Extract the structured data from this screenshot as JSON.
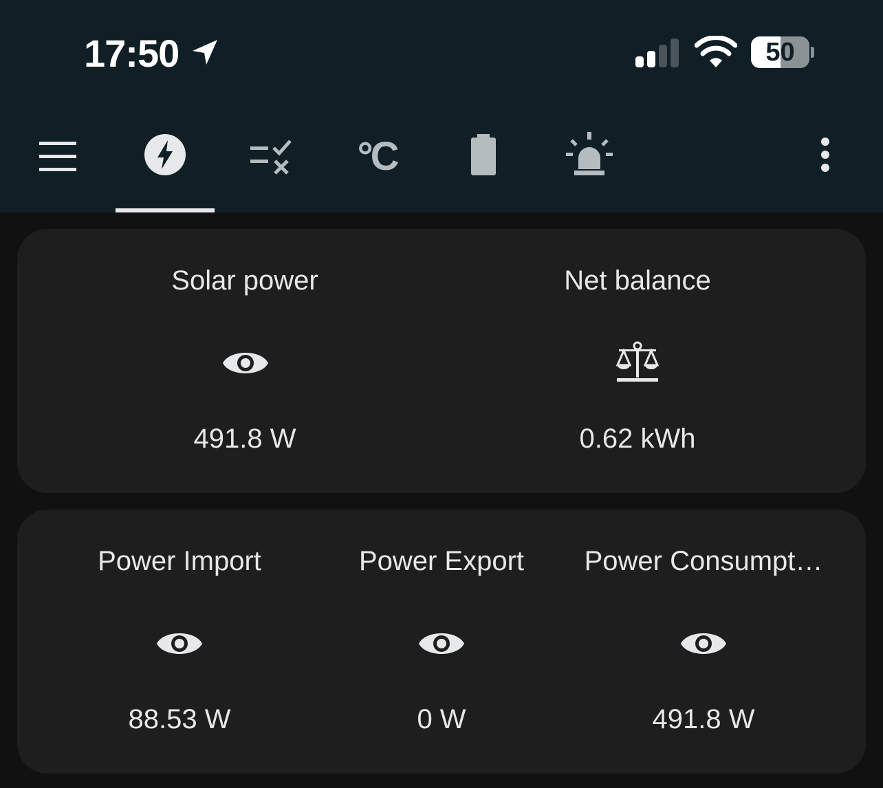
{
  "status_bar": {
    "time": "17:50",
    "location_icon": "location-arrow-icon",
    "signal_icon": "cellular-signal-icon",
    "wifi_icon": "wifi-icon",
    "battery_percent": "50",
    "battery_level": 0.5
  },
  "toolbar": {
    "menu_icon": "menu-icon",
    "tabs": [
      {
        "icon": "lightning-bolt-icon",
        "selected": true
      },
      {
        "icon": "checklist-icon",
        "selected": false
      },
      {
        "icon": "celsius-icon",
        "label": "°C",
        "selected": false
      },
      {
        "icon": "battery-icon",
        "selected": false
      },
      {
        "icon": "alarm-light-icon",
        "selected": false
      }
    ],
    "overflow_icon": "more-vertical-icon"
  },
  "cards": [
    {
      "tiles": [
        {
          "name": "Solar power",
          "icon": "eye-icon",
          "value": "491.8 W"
        },
        {
          "name": "Net balance",
          "icon": "scale-balance-icon",
          "value": "0.62 kWh"
        }
      ]
    },
    {
      "tiles": [
        {
          "name": "Power Import",
          "icon": "eye-icon",
          "value": "88.53 W"
        },
        {
          "name": "Power Export",
          "icon": "eye-icon",
          "value": "0 W"
        },
        {
          "name": "Power Consumpt…",
          "icon": "eye-icon",
          "value": "491.8 W"
        }
      ]
    }
  ],
  "colors": {
    "header_bg": "#101e25",
    "page_bg": "#111111",
    "card_bg": "#1e1e1e",
    "icon_gray": "#b4bcc0",
    "text": "#e8e8e8"
  }
}
